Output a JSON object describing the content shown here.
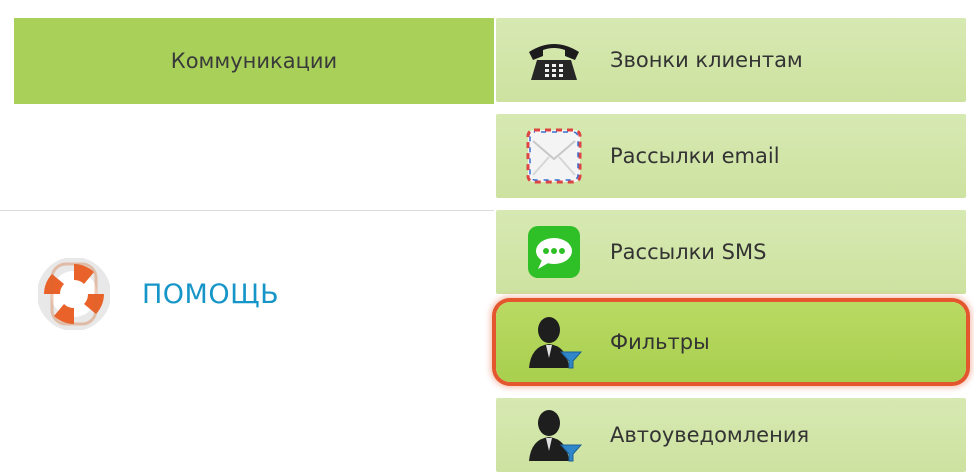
{
  "sidebar": {
    "header": "Коммуникации",
    "help_label": "ПОМОЩЬ"
  },
  "menu": {
    "items": [
      {
        "label": "Звонки клиентам",
        "icon": "telephone-icon"
      },
      {
        "label": "Рассылки email",
        "icon": "envelope-icon"
      },
      {
        "label": "Рассылки SMS",
        "icon": "sms-chat-icon"
      },
      {
        "label": "Фильтры",
        "icon": "user-filter-icon",
        "highlighted": true
      },
      {
        "label": "Автоуведомления",
        "icon": "user-filter-icon"
      }
    ]
  },
  "colors": {
    "header_green": "#a9d15a",
    "menu_item_bg": "#d2e6a8",
    "highlight_ring": "#e4572e",
    "help_blue": "#1696c8"
  }
}
